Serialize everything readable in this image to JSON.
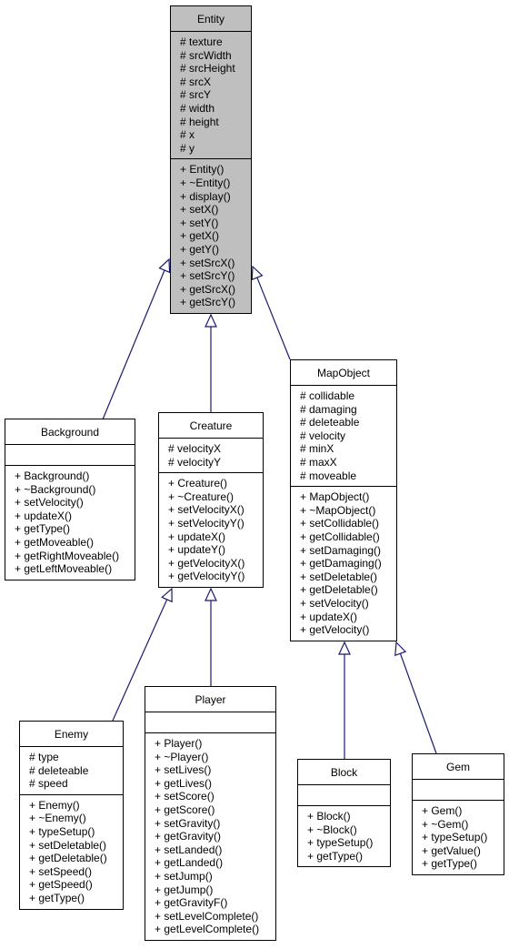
{
  "diagram": {
    "type": "uml-class-inheritance",
    "edge_color": "#191970",
    "root_fill": "#bfbfbf",
    "classes": [
      {
        "id": "entity",
        "name": "Entity",
        "attributes": [
          "# texture",
          "# srcWidth",
          "# srcHeight",
          "# srcX",
          "# srcY",
          "# width",
          "# height",
          "# x",
          "# y"
        ],
        "methods": [
          "+ Entity()",
          "+ ~Entity()",
          "+ display()",
          "+ setX()",
          "+ setY()",
          "+ getX()",
          "+ getY()",
          "+ setSrcX()",
          "+ setSrcY()",
          "+ getSrcX()",
          "+ getSrcY()"
        ]
      },
      {
        "id": "background",
        "name": "Background",
        "attributes": [],
        "methods": [
          "+ Background()",
          "+ ~Background()",
          "+ setVelocity()",
          "+ updateX()",
          "+ getType()",
          "+ getMoveable()",
          "+ getRightMoveable()",
          "+ getLeftMoveable()"
        ]
      },
      {
        "id": "creature",
        "name": "Creature",
        "attributes": [
          "# velocityX",
          "# velocityY"
        ],
        "methods": [
          "+ Creature()",
          "+ ~Creature()",
          "+ setVelocityX()",
          "+ setVelocityY()",
          "+ updateX()",
          "+ updateY()",
          "+ getVelocityX()",
          "+ getVelocityY()"
        ]
      },
      {
        "id": "mapobject",
        "name": "MapObject",
        "attributes": [
          "# collidable",
          "# damaging",
          "# deleteable",
          "# velocity",
          "# minX",
          "# maxX",
          "# moveable"
        ],
        "methods": [
          "+ MapObject()",
          "+ ~MapObject()",
          "+ setCollidable()",
          "+ getCollidable()",
          "+ setDamaging()",
          "+ getDamaging()",
          "+ setDeletable()",
          "+ getDeletable()",
          "+ setVelocity()",
          "+ updateX()",
          "+ getVelocity()"
        ]
      },
      {
        "id": "enemy",
        "name": "Enemy",
        "attributes": [
          "# type",
          "# deleteable",
          "# speed"
        ],
        "methods": [
          "+ Enemy()",
          "+ ~Enemy()",
          "+ typeSetup()",
          "+ setDeletable()",
          "+ getDeletable()",
          "+ setSpeed()",
          "+ getSpeed()",
          "+ getType()"
        ]
      },
      {
        "id": "player",
        "name": "Player",
        "attributes": [],
        "methods": [
          "+ Player()",
          "+ ~Player()",
          "+ setLives()",
          "+ getLives()",
          "+ setScore()",
          "+ getScore()",
          "+ setGravity()",
          "+ getGravity()",
          "+ setLanded()",
          "+ getLanded()",
          "+ setJump()",
          "+ getJump()",
          "+ getGravityF()",
          "+ setLevelComplete()",
          "+ getLevelComplete()"
        ]
      },
      {
        "id": "block",
        "name": "Block",
        "attributes": [],
        "methods": [
          "+ Block()",
          "+ ~Block()",
          "+ typeSetup()",
          "+ getType()"
        ]
      },
      {
        "id": "gem",
        "name": "Gem",
        "attributes": [],
        "methods": [
          "+ Gem()",
          "+ ~Gem()",
          "+ typeSetup()",
          "+ getValue()",
          "+ getType()"
        ]
      }
    ],
    "inheritance": [
      {
        "child": "background",
        "parent": "entity"
      },
      {
        "child": "creature",
        "parent": "entity"
      },
      {
        "child": "mapobject",
        "parent": "entity"
      },
      {
        "child": "enemy",
        "parent": "creature"
      },
      {
        "child": "player",
        "parent": "creature"
      },
      {
        "child": "block",
        "parent": "mapobject"
      },
      {
        "child": "gem",
        "parent": "mapobject"
      }
    ]
  }
}
